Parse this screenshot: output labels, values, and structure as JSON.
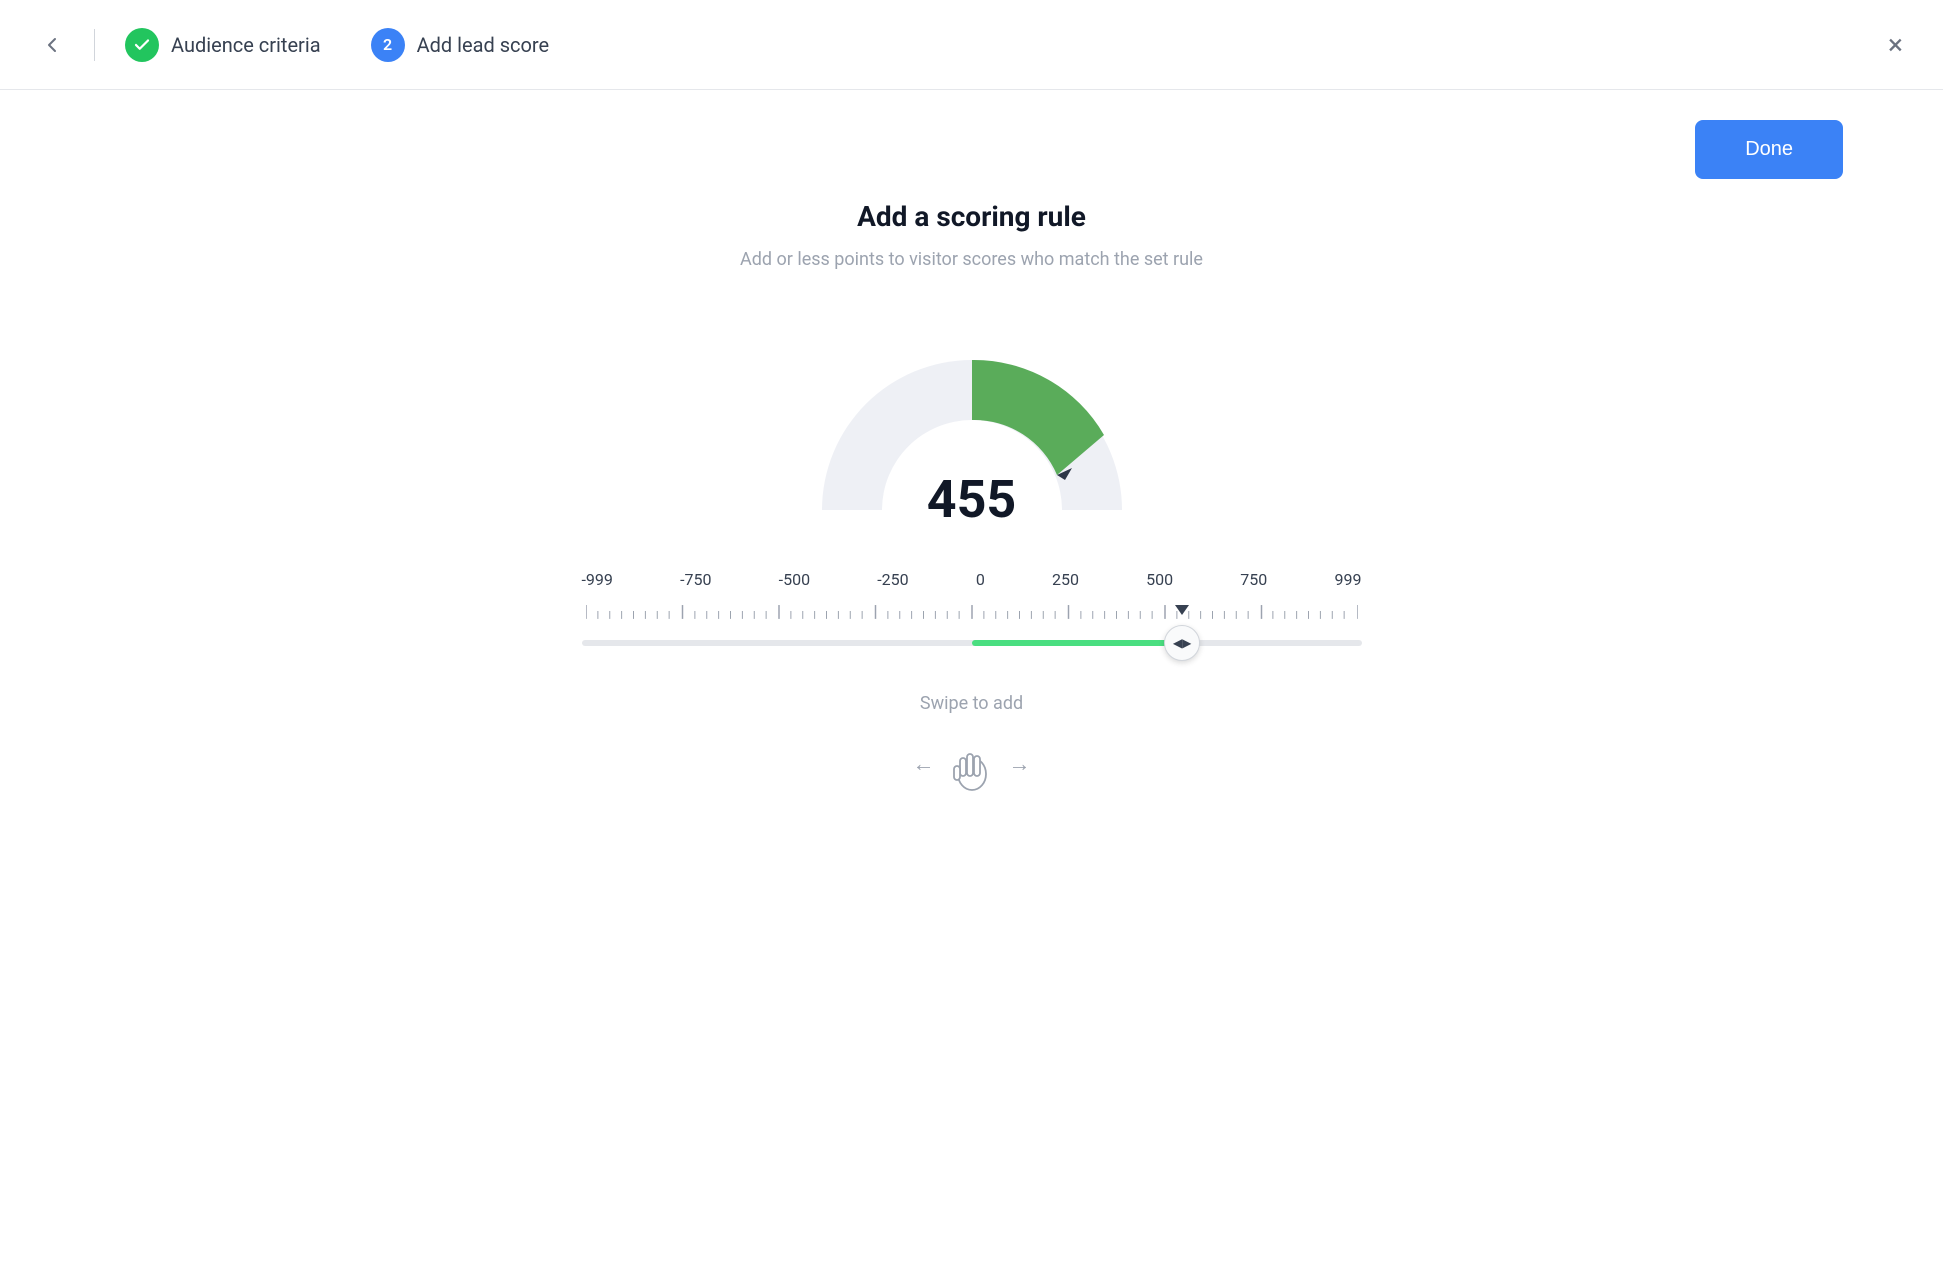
{
  "header": {
    "back_label": "←",
    "step1": {
      "badge": "✓",
      "label": "Audience criteria",
      "status": "completed"
    },
    "step2": {
      "badge": "2",
      "label": "Add lead score",
      "status": "active"
    },
    "close_label": "×"
  },
  "toolbar": {
    "done_label": "Done"
  },
  "main": {
    "title": "Add a scoring rule",
    "subtitle": "Add or less points to visitor scores who match the set rule",
    "gauge_value": "455",
    "swipe_label": "Swipe to add"
  },
  "scale": {
    "labels": [
      "-999",
      "-750",
      "-500",
      "-250",
      "0",
      "250",
      "500",
      "750",
      "999"
    ]
  }
}
